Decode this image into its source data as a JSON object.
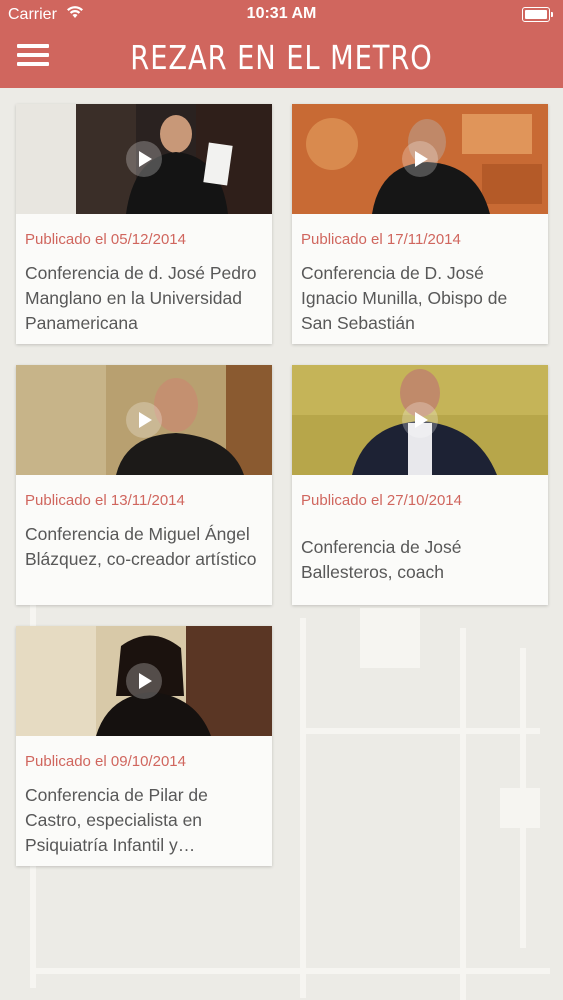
{
  "status_bar": {
    "carrier": "Carrier",
    "time": "10:31 AM",
    "wifi_icon": "wifi-icon",
    "battery_icon": "battery-icon"
  },
  "nav": {
    "title": "REZAR EN EL METRO",
    "menu_icon": "hamburger-menu-icon",
    "color": "#d0665e"
  },
  "videos": [
    {
      "date": "Publicado el 05/12/2014",
      "title": "Conferencia de d. José Pedro Manglano en la Universidad Panamericana"
    },
    {
      "date": "Publicado el 17/11/2014",
      "title": "Conferencia de D. José Ignacio Munilla, Obispo de San Sebastián"
    },
    {
      "date": "Publicado el 13/11/2014",
      "title": "Conferencia de Miguel Ángel Blázquez, co-creador artístico"
    },
    {
      "date": "Publicado el 27/10/2014",
      "title": "Conferencia de José Ballesteros, coach"
    },
    {
      "date": "Publicado el 09/10/2014",
      "title": "Conferencia de Pilar de Castro, especialista en Psiquiatría Infantil y Adolescente"
    }
  ],
  "play_icon": "play-icon"
}
